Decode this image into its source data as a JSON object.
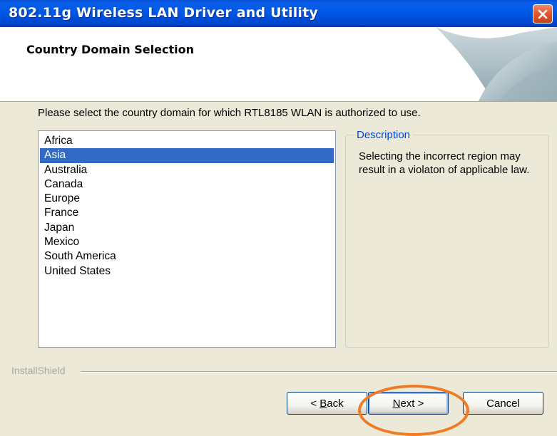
{
  "window": {
    "title": "802.11g Wireless LAN Driver and Utility",
    "close_icon": "close-icon"
  },
  "header": {
    "title": "Country Domain Selection"
  },
  "instruction": "Please select the country domain for which RTL8185 WLAN is authorized to use.",
  "country_list": {
    "items": [
      "Africa",
      "Asia",
      "Australia",
      "Canada",
      "Europe",
      "France",
      "Japan",
      "Mexico",
      "South America",
      "United States"
    ],
    "selected": "Asia"
  },
  "description": {
    "legend": "Description",
    "text": "Selecting the incorrect region may result in a violaton of applicable law."
  },
  "footer": {
    "brand": "InstallShield"
  },
  "buttons": {
    "back_prefix": "< ",
    "back_mnemonic": "B",
    "back_rest": "ack",
    "next_mnemonic": "N",
    "next_rest": "ext >",
    "cancel": "Cancel"
  },
  "colors": {
    "titlebar": "#0058e6",
    "selection": "#316ac5",
    "highlight_ring": "#f07b22"
  }
}
